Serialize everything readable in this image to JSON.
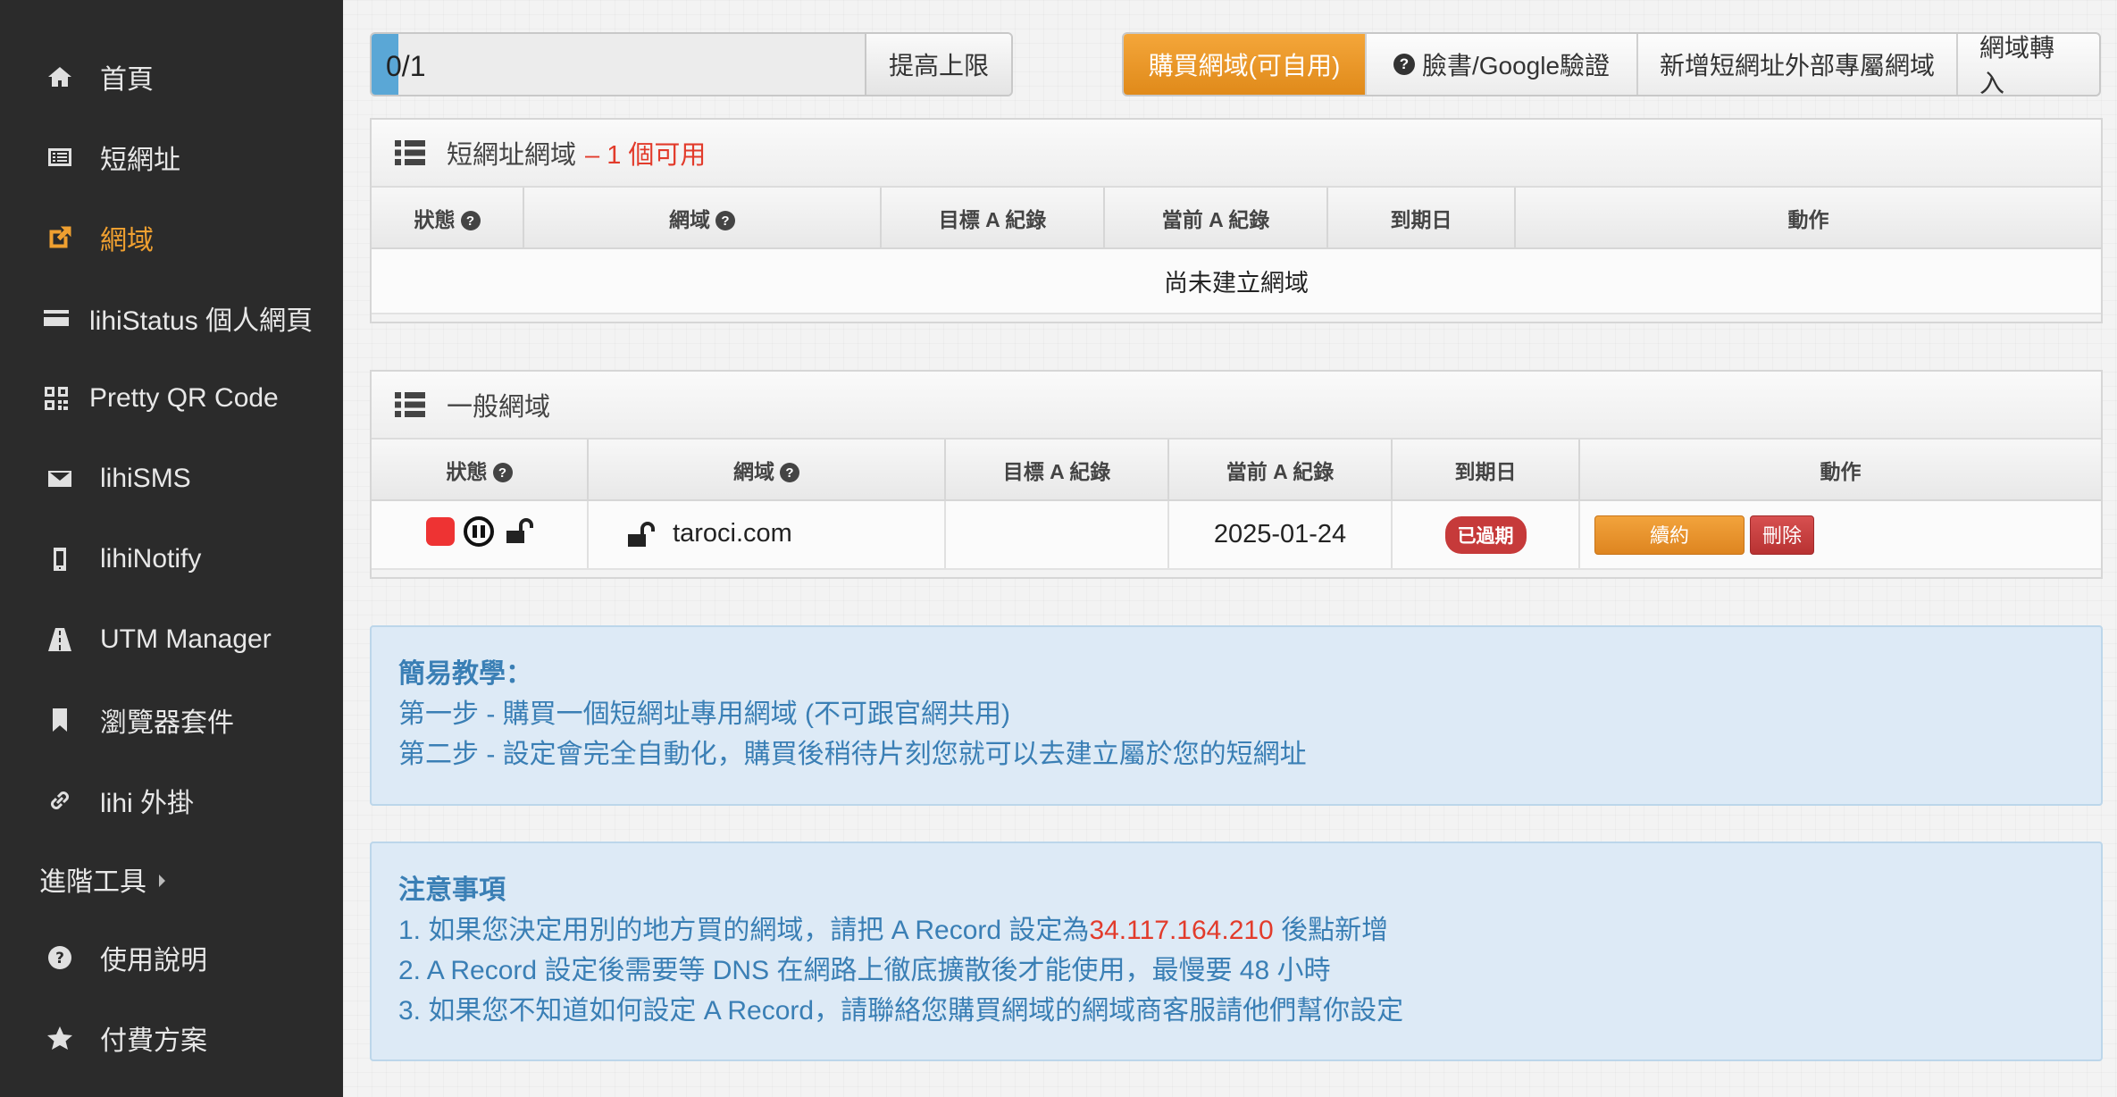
{
  "sidebar": {
    "items": [
      {
        "label": "首頁",
        "icon": "home-icon"
      },
      {
        "label": "短網址",
        "icon": "list-alt-icon"
      },
      {
        "label": "網域",
        "icon": "external-link-icon"
      },
      {
        "label": "lihiStatus 個人網頁",
        "icon": "credit-card-icon"
      },
      {
        "label": "Pretty QR Code",
        "icon": "qrcode-icon"
      },
      {
        "label": "lihiSMS",
        "icon": "envelope-icon"
      },
      {
        "label": "lihiNotify",
        "icon": "mobile-icon"
      },
      {
        "label": "UTM Manager",
        "icon": "road-icon"
      },
      {
        "label": "瀏覽器套件",
        "icon": "bookmark-icon"
      },
      {
        "label": "lihi 外掛",
        "icon": "link-icon"
      },
      {
        "label": "進階工具",
        "icon": "caret-right-icon"
      },
      {
        "label": "使用說明",
        "icon": "question-circle-icon"
      },
      {
        "label": "付費方案",
        "icon": "star-icon"
      }
    ],
    "active": "網域"
  },
  "quota": {
    "text": "0/1",
    "fill_fraction": 0.0,
    "raise_label": "提高上限"
  },
  "actions": {
    "buy": "購買網域(可自用)",
    "verify": "臉書/Google驗證",
    "add_external": "新增短網址外部專屬網域",
    "transfer": "網域轉入"
  },
  "short_panel": {
    "title": "短網址網域",
    "available": "– 1 個可用",
    "columns": [
      "狀態",
      "網域",
      "目標 A 紀錄",
      "當前 A 紀錄",
      "到期日",
      "動作"
    ],
    "empty_text": "尚未建立網域"
  },
  "general_panel": {
    "title": "一般網域",
    "columns": [
      "狀態",
      "網域",
      "目標 A 紀錄",
      "當前 A 紀錄",
      "到期日",
      "動作"
    ],
    "rows": [
      {
        "domain": "taroci.com",
        "target_a": "",
        "current_a": "2025-01-24",
        "expiry_badge": "已過期",
        "renew": "續約",
        "delete": "刪除"
      }
    ]
  },
  "tutorial": {
    "title": "簡易教學：",
    "step1": "第一步 - 購買一個短網址專用網域 (不可跟官網共用)",
    "step2": "第二步 - 設定會完全自動化，購買後稍待片刻您就可以去建立屬於您的短網址"
  },
  "notes": {
    "title": "注意事項",
    "line1_pre": "1. 如果您決定用別的地方買的網域，請把 A Record 設定為",
    "line1_ip": "34.117.164.210",
    "line1_post": " 後點新增",
    "line2": "2. A Record 設定後需要等 DNS 在網路上徹底擴散後才能使用，最慢要 48 小時",
    "line3": "3. 如果您不知道如何設定 A Record，請聯絡您購買網域的網域商客服請他們幫你設定"
  },
  "colors": {
    "sidebar_bg": "#2b2b2b",
    "accent_orange": "#f0a030",
    "danger_red": "#e23b2b",
    "info_blue": "#3a7fb5"
  }
}
